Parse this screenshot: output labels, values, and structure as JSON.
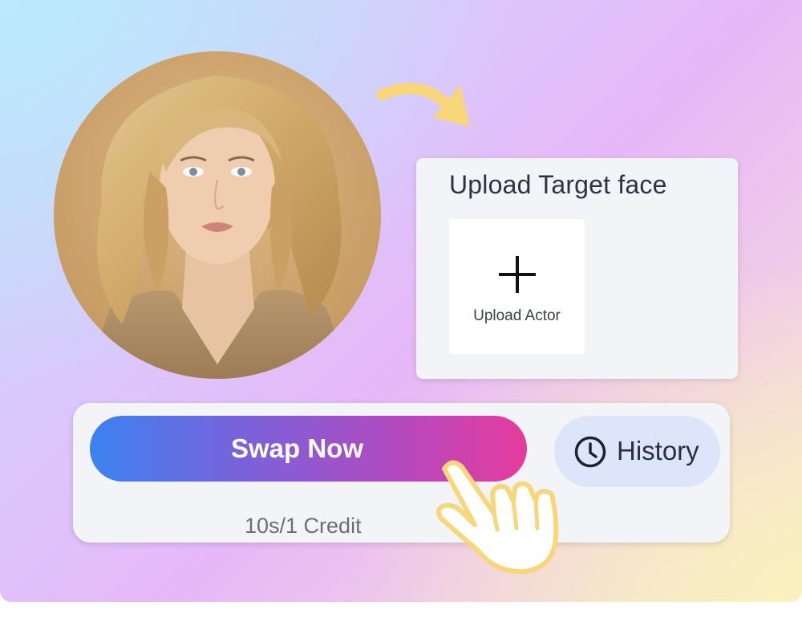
{
  "upload": {
    "title": "Upload Target face",
    "tile_label": "Upload Actor",
    "tile_icon": "plus-icon"
  },
  "actions": {
    "swap_label": "Swap Now",
    "history_label": "History",
    "history_icon": "clock-icon",
    "credit_text": "10s/1 Credit"
  },
  "decorations": {
    "arrow_icon": "curved-arrow-icon",
    "pointer_icon": "hand-pointer-icon"
  },
  "colors": {
    "swap_gradient_start": "#3c82f0",
    "swap_gradient_end": "#e63b9d",
    "history_bg": "#dde5fb",
    "arrow_color": "#f7d67c",
    "card_bg": "#f3f4f8"
  }
}
